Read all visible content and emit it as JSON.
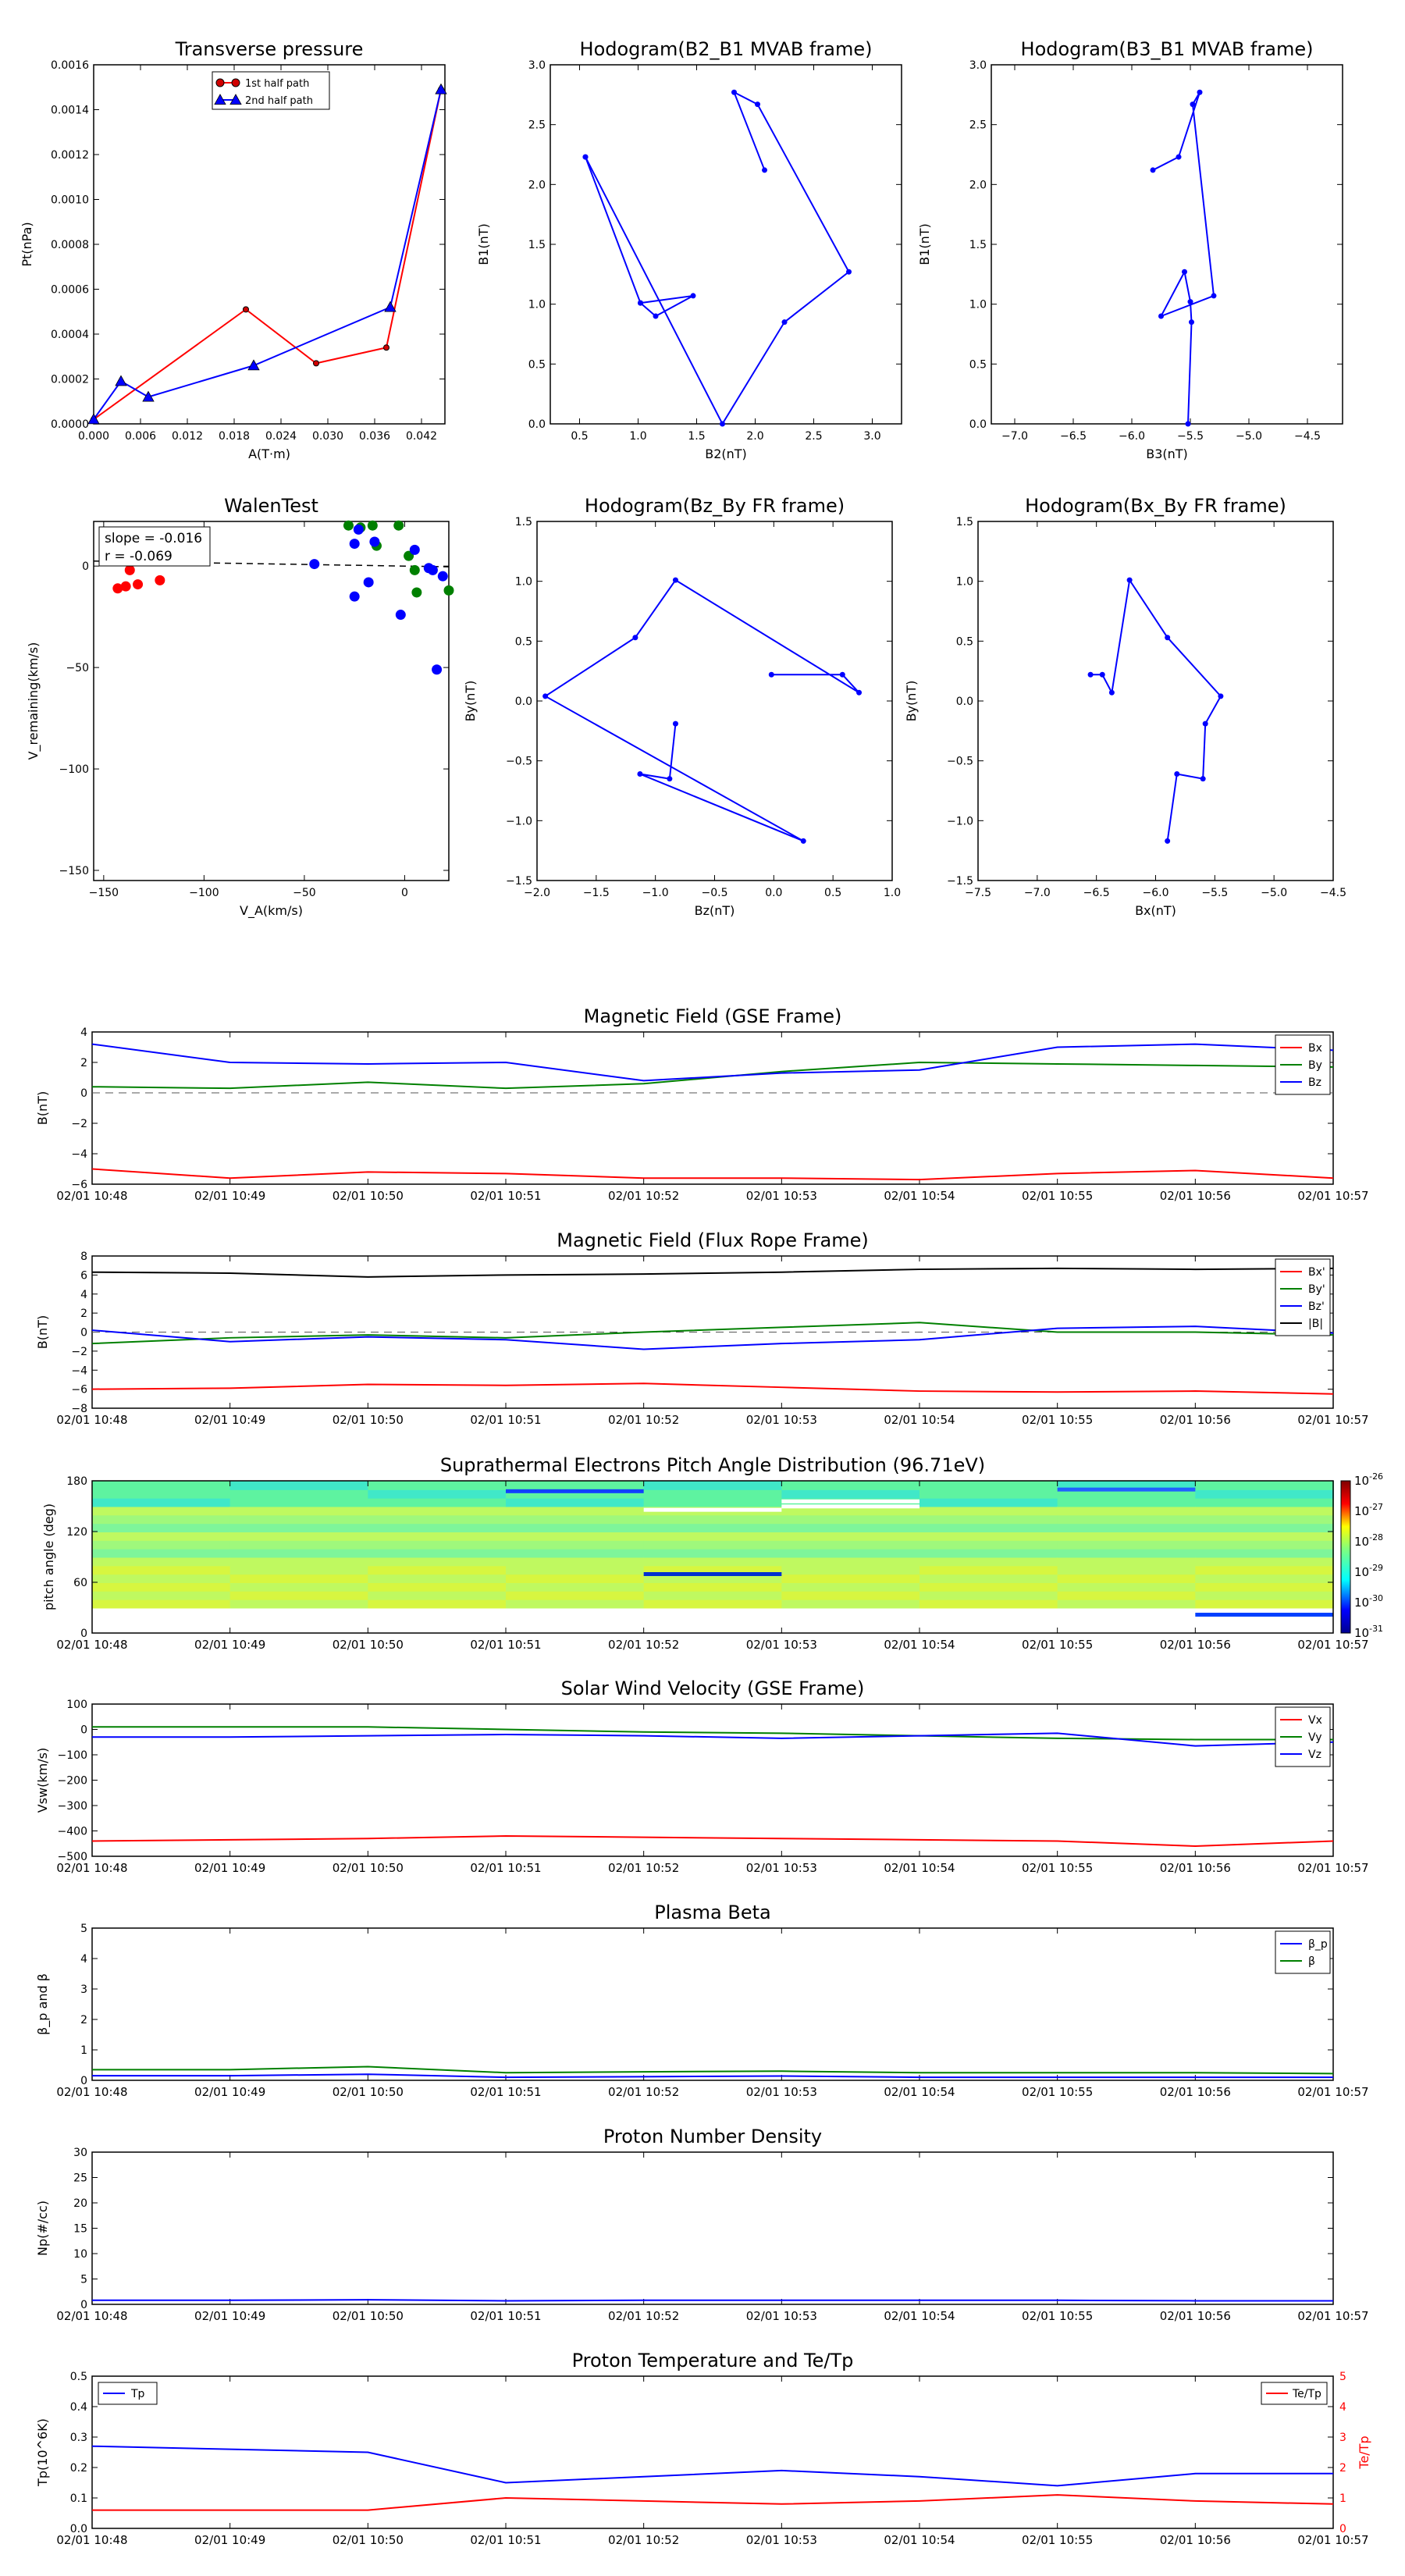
{
  "colors": {
    "red": "#ff0000",
    "green": "#008000",
    "blue": "#0000ff",
    "black": "#000000",
    "gray": "#555555"
  },
  "time_ticks": [
    "02/01 10:48",
    "02/01 10:49",
    "02/01 10:50",
    "02/01 10:51",
    "02/01 10:52",
    "02/01 10:53",
    "02/01 10:54",
    "02/01 10:55",
    "02/01 10:56",
    "02/01 10:57"
  ],
  "chart_data": [
    {
      "id": "transverse-pressure",
      "type": "line",
      "title": "Transverse pressure",
      "xlabel": "A(T·m)",
      "ylabel": "Pt(nPa)",
      "xlim": [
        0,
        0.045
      ],
      "ylim": [
        0,
        0.0016
      ],
      "xticks": [
        "0.000",
        "0.006",
        "0.012",
        "0.018",
        "0.024",
        "0.030",
        "0.036",
        "0.042"
      ],
      "yticks": [
        "0.0000",
        "0.0002",
        "0.0004",
        "0.0006",
        "0.0008",
        "0.0010",
        "0.0012",
        "0.0014",
        "0.0016"
      ],
      "legend": "upper-center",
      "series": [
        {
          "name": "1st half path",
          "marker": "circle",
          "color": "red",
          "x": [
            0.0,
            0.0195,
            0.0285,
            0.0375,
            0.0445
          ],
          "y": [
            2e-05,
            0.00051,
            0.00027,
            0.00034,
            0.00149
          ]
        },
        {
          "name": "2nd half path",
          "marker": "triangle",
          "color": "blue",
          "x": [
            0.0,
            0.0035,
            0.007,
            0.0205,
            0.038,
            0.0445
          ],
          "y": [
            2e-05,
            0.00019,
            0.00012,
            0.00026,
            0.00052,
            0.00149
          ]
        }
      ]
    },
    {
      "id": "hodogram-b2-b1",
      "type": "line",
      "title": "Hodogram(B2_B1 MVAB frame)",
      "xlabel": "B2(nT)",
      "ylabel": "B1(nT)",
      "xlim": [
        0.25,
        3.25
      ],
      "ylim": [
        0,
        3.0
      ],
      "xticks": [
        "0.5",
        "1.0",
        "1.5",
        "2.0",
        "2.5",
        "3.0"
      ],
      "yticks": [
        "0.0",
        "0.5",
        "1.0",
        "1.5",
        "2.0",
        "2.5",
        "3.0"
      ],
      "series": [
        {
          "color": "blue",
          "x": [
            0.55,
            1.72,
            2.25,
            2.8,
            2.02,
            1.82,
            2.08
          ],
          "y": [
            2.23,
            0.0,
            0.85,
            1.27,
            2.67,
            2.77,
            2.12
          ]
        },
        {
          "color": "blue",
          "x": [
            0.55,
            1.02,
            1.47,
            1.15,
            1.02
          ],
          "y": [
            2.23,
            1.01,
            1.07,
            0.9,
            1.01
          ]
        }
      ]
    },
    {
      "id": "hodogram-b3-b1",
      "type": "line",
      "title": "Hodogram(B3_B1 MVAB frame)",
      "xlabel": "B3(nT)",
      "ylabel": "B1(nT)",
      "xlim": [
        -7.2,
        -4.2
      ],
      "ylim": [
        0,
        3.0
      ],
      "xticks": [
        "−7.0",
        "−6.5",
        "−6.0",
        "−5.5",
        "−5.0",
        "−4.5"
      ],
      "yticks": [
        "0.0",
        "0.5",
        "1.0",
        "1.5",
        "2.0",
        "2.5",
        "3.0"
      ],
      "series": [
        {
          "color": "blue",
          "x": [
            -5.52,
            -5.49,
            -5.5,
            -5.55,
            -5.75,
            -5.3,
            -5.48,
            -5.42,
            -5.6,
            -5.82
          ],
          "y": [
            0.0,
            0.85,
            1.02,
            1.27,
            0.9,
            1.07,
            2.67,
            2.77,
            2.23,
            2.12
          ]
        }
      ]
    },
    {
      "id": "walen-test",
      "type": "scatter",
      "title": "WalenTest",
      "xlabel": "V_A(km/s)",
      "ylabel": "V_remaining(km/s)",
      "xlim": [
        -155,
        22
      ],
      "ylim": [
        -155,
        22
      ],
      "xticks": [
        "−150",
        "−100",
        "−50",
        "0"
      ],
      "yticks": [
        "−150",
        "−100",
        "−50",
        "0"
      ],
      "annotation": [
        "slope = -0.016",
        "r = -0.069"
      ],
      "fit": {
        "slope": -0.016,
        "intercept": 0
      },
      "series": [
        {
          "color": "red",
          "x": [
            -143,
            -139,
            -137,
            -133,
            -122
          ],
          "y": [
            -11,
            -10,
            -2,
            -9,
            -7
          ]
        },
        {
          "color": "green",
          "x": [
            -28,
            -22,
            -16,
            -14,
            -3,
            2,
            5,
            6,
            22
          ],
          "y": [
            20,
            19,
            20,
            10,
            20,
            5,
            -2,
            -13,
            -12
          ]
        },
        {
          "color": "blue",
          "x": [
            -45,
            -25,
            -25,
            -23,
            -18,
            -15,
            -2,
            5,
            12,
            14,
            16,
            19
          ],
          "y": [
            1,
            11,
            -15,
            18,
            -8,
            12,
            -24,
            8,
            -1,
            -2,
            -51,
            -5
          ]
        }
      ]
    },
    {
      "id": "hodogram-bz-by",
      "type": "line",
      "title": "Hodogram(Bz_By FR frame)",
      "xlabel": "Bz(nT)",
      "ylabel": "By(nT)",
      "xlim": [
        -2.0,
        1.0
      ],
      "ylim": [
        -1.5,
        1.5
      ],
      "xticks": [
        "−2.0",
        "−1.5",
        "−1.0",
        "−0.5",
        "0.0",
        "0.5",
        "1.0"
      ],
      "yticks": [
        "−1.5",
        "−1.0",
        "−0.5",
        "0.0",
        "0.5",
        "1.0",
        "1.5"
      ],
      "series": [
        {
          "color": "blue",
          "x": [
            -0.02,
            0.58,
            0.72,
            -0.83,
            -1.17,
            -1.93,
            0.25,
            -1.13,
            -0.88,
            -0.83
          ],
          "y": [
            0.22,
            0.22,
            0.07,
            1.01,
            0.53,
            0.04,
            -1.17,
            -0.61,
            -0.65,
            -0.19
          ]
        }
      ]
    },
    {
      "id": "hodogram-bx-by",
      "type": "line",
      "title": "Hodogram(Bx_By FR frame)",
      "xlabel": "Bx(nT)",
      "ylabel": "By(nT)",
      "xlim": [
        -7.5,
        -4.5
      ],
      "ylim": [
        -1.5,
        1.5
      ],
      "xticks": [
        "−7.5",
        "−7.0",
        "−6.5",
        "−6.0",
        "−5.5",
        "−5.0",
        "−4.5"
      ],
      "yticks": [
        "−1.5",
        "−1.0",
        "−0.5",
        "0.0",
        "0.5",
        "1.0",
        "1.5"
      ],
      "series": [
        {
          "color": "blue",
          "x": [
            -6.55,
            -6.45,
            -6.37,
            -6.22,
            -5.9,
            -5.45,
            -5.58,
            -5.6,
            -5.82,
            -5.9
          ],
          "y": [
            0.22,
            0.22,
            0.07,
            1.01,
            0.53,
            0.04,
            -0.19,
            -0.65,
            -0.61,
            -1.17
          ]
        }
      ]
    },
    {
      "id": "magnetic-field-gse",
      "type": "line",
      "title": "Magnetic Field (GSE Frame)",
      "ylabel": "B(nT)",
      "ylim": [
        -6,
        4
      ],
      "yticks": [
        "−6",
        "−4",
        "−2",
        "0",
        "2",
        "4"
      ],
      "x": [
        0,
        1,
        2,
        3,
        4,
        5,
        6,
        7,
        8,
        9
      ],
      "legend": "right",
      "zero_line": true,
      "series": [
        {
          "name": "Bx",
          "color": "red",
          "values": [
            -5.0,
            -5.6,
            -5.2,
            -5.3,
            -5.6,
            -5.6,
            -5.7,
            -5.3,
            -5.1,
            -5.6
          ]
        },
        {
          "name": "By",
          "color": "green",
          "values": [
            0.4,
            0.3,
            0.7,
            0.3,
            0.6,
            1.4,
            2.0,
            1.9,
            1.8,
            1.7
          ]
        },
        {
          "name": "Bz",
          "color": "blue",
          "values": [
            3.2,
            2.0,
            1.9,
            2.0,
            0.8,
            1.3,
            1.5,
            3.0,
            3.2,
            2.8
          ]
        }
      ]
    },
    {
      "id": "magnetic-field-fr",
      "type": "line",
      "title": "Magnetic Field (Flux Rope Frame)",
      "ylabel": "B(nT)",
      "ylim": [
        -8,
        8
      ],
      "yticks": [
        "−8",
        "−6",
        "−4",
        "−2",
        "0",
        "2",
        "4",
        "6",
        "8"
      ],
      "x": [
        0,
        1,
        2,
        3,
        4,
        5,
        6,
        7,
        8,
        9
      ],
      "legend": "right",
      "zero_line": true,
      "series": [
        {
          "name": "Bx'",
          "color": "red",
          "values": [
            -6.0,
            -5.9,
            -5.5,
            -5.6,
            -5.4,
            -5.8,
            -6.2,
            -6.3,
            -6.2,
            -6.5
          ]
        },
        {
          "name": "By'",
          "color": "green",
          "values": [
            -1.2,
            -0.6,
            -0.3,
            -0.6,
            0.0,
            0.5,
            1.0,
            0.0,
            0.0,
            -0.3
          ]
        },
        {
          "name": "Bz'",
          "color": "blue",
          "values": [
            0.2,
            -1.0,
            -0.5,
            -0.8,
            -1.8,
            -1.2,
            -0.8,
            0.4,
            0.6,
            -0.1
          ]
        },
        {
          "name": "|B|",
          "color": "black",
          "values": [
            6.3,
            6.2,
            5.8,
            6.0,
            6.1,
            6.3,
            6.6,
            6.7,
            6.6,
            6.7
          ]
        }
      ]
    },
    {
      "id": "pitch-angle-distribution",
      "type": "heatmap",
      "title": "Suprathermal Electrons Pitch Angle Distribution (96.71eV)",
      "ylabel": "pitch angle (deg)",
      "ylim": [
        0,
        180
      ],
      "yticks": [
        "0",
        "60",
        "120",
        "180"
      ],
      "colorbar": {
        "scale": "log",
        "ticks": [
          "10^-26",
          "10^-27",
          "10^-28",
          "10^-29",
          "10^-30",
          "10^-31"
        ]
      }
    },
    {
      "id": "solar-wind-velocity",
      "type": "line",
      "title": "Solar Wind Velocity (GSE Frame)",
      "ylabel": "Vsw(km/s)",
      "ylim": [
        -500,
        100
      ],
      "yticks": [
        "−500",
        "−400",
        "−300",
        "−200",
        "−100",
        "0",
        "100"
      ],
      "x": [
        0,
        1,
        2,
        3,
        4,
        5,
        6,
        7,
        8,
        9
      ],
      "legend": "right",
      "series": [
        {
          "name": "Vx",
          "color": "red",
          "values": [
            -440,
            -435,
            -430,
            -420,
            -425,
            -430,
            -435,
            -440,
            -460,
            -440
          ]
        },
        {
          "name": "Vy",
          "color": "green",
          "values": [
            10,
            10,
            10,
            0,
            -10,
            -15,
            -25,
            -35,
            -40,
            -40
          ]
        },
        {
          "name": "Vz",
          "color": "blue",
          "values": [
            -30,
            -30,
            -25,
            -20,
            -25,
            -35,
            -25,
            -15,
            -65,
            -50
          ]
        }
      ]
    },
    {
      "id": "plasma-beta",
      "type": "line",
      "title": "Plasma Beta",
      "ylabel": "β_p and β",
      "ylim": [
        0,
        5
      ],
      "yticks": [
        "0",
        "1",
        "2",
        "3",
        "4",
        "5"
      ],
      "x": [
        0,
        1,
        2,
        3,
        4,
        5,
        6,
        7,
        8,
        9
      ],
      "legend": "right",
      "series": [
        {
          "name": "β_p",
          "color": "blue",
          "values": [
            0.15,
            0.15,
            0.2,
            0.1,
            0.12,
            0.14,
            0.1,
            0.1,
            0.1,
            0.1
          ]
        },
        {
          "name": "β",
          "color": "green",
          "values": [
            0.35,
            0.35,
            0.45,
            0.25,
            0.28,
            0.3,
            0.25,
            0.25,
            0.25,
            0.22
          ]
        }
      ]
    },
    {
      "id": "proton-number-density",
      "type": "line",
      "title": "Proton Number Density",
      "ylabel": "Np(#/cc)",
      "ylim": [
        0,
        30
      ],
      "yticks": [
        "0",
        "5",
        "10",
        "15",
        "20",
        "25",
        "30"
      ],
      "x": [
        0,
        1,
        2,
        3,
        4,
        5,
        6,
        7,
        8,
        9
      ],
      "series": [
        {
          "color": "blue",
          "values": [
            0.8,
            0.8,
            0.9,
            0.7,
            0.8,
            0.8,
            0.8,
            0.8,
            0.7,
            0.7
          ]
        }
      ]
    },
    {
      "id": "proton-temperature",
      "type": "line",
      "title": "Proton Temperature and Te/Tp",
      "ylabel": "Tp(10^6K)",
      "ylim": [
        0,
        0.5
      ],
      "yticks": [
        "0.0",
        "0.1",
        "0.2",
        "0.3",
        "0.4",
        "0.5"
      ],
      "y2label": "Te/Tp",
      "y2lim": [
        0,
        5
      ],
      "y2ticks": [
        "0",
        "1",
        "2",
        "3",
        "4",
        "5"
      ],
      "x": [
        0,
        1,
        2,
        3,
        4,
        5,
        6,
        7,
        8,
        9
      ],
      "series": [
        {
          "name": "Tp",
          "color": "blue",
          "axis": "left",
          "values": [
            0.27,
            0.26,
            0.25,
            0.15,
            0.17,
            0.19,
            0.17,
            0.14,
            0.18,
            0.18
          ]
        },
        {
          "name": "Te/Tp",
          "color": "red",
          "axis": "right",
          "values": [
            0.6,
            0.6,
            0.6,
            1.0,
            0.9,
            0.8,
            0.9,
            1.1,
            0.9,
            0.8
          ]
        }
      ]
    }
  ]
}
